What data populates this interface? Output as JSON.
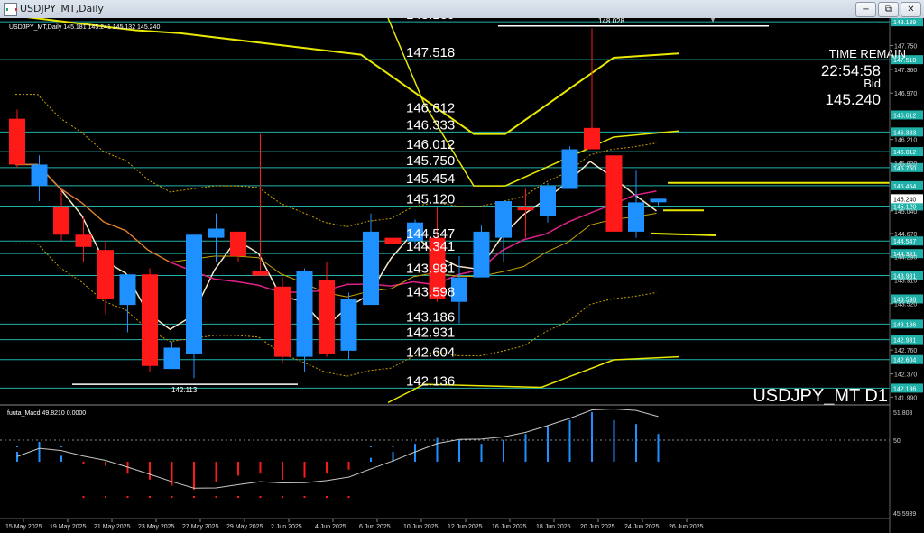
{
  "window": {
    "title": "USDJPY_MT,Daily",
    "minimize_glyph": "−",
    "restore_glyph": "⧉",
    "close_glyph": "✕"
  },
  "chart_header": "USDJPY_MT,Daily  145.181 145.241 145.132 145.240",
  "watermark": "USDJPY_MT D1",
  "time_remain": {
    "label": "TIME REMAIN",
    "value": "22:54:58",
    "bid_label": "Bid",
    "bid_value": "145.240"
  },
  "level_labels": [
    {
      "text": "148.139",
      "y": 148.139
    },
    {
      "text": "147.518",
      "y": 147.518
    },
    {
      "text": "146.612",
      "y": 146.612
    },
    {
      "text": "146.333",
      "y": 146.333
    },
    {
      "text": "146.012",
      "y": 146.012
    },
    {
      "text": "145.750",
      "y": 145.75
    },
    {
      "text": "145.454",
      "y": 145.454
    },
    {
      "text": "145.120",
      "y": 145.12
    },
    {
      "text": "144.547",
      "y": 144.547
    },
    {
      "text": "144.341",
      "y": 144.341
    },
    {
      "text": "143.981",
      "y": 143.981
    },
    {
      "text": "143.598",
      "y": 143.598
    },
    {
      "text": "143.186",
      "y": 143.186
    },
    {
      "text": "142.931",
      "y": 142.931
    },
    {
      "text": "142.604",
      "y": 142.604
    },
    {
      "text": "142.136",
      "y": 142.136
    }
  ],
  "high_marker": "148.028",
  "low_marker": "142.113",
  "price_scale_ticks": [
    "147.750",
    "147.360",
    "146.970",
    "146.210",
    "145.820",
    "145.040",
    "144.670",
    "144.290",
    "143.910",
    "143.520",
    "142.760",
    "142.370",
    "141.990"
  ],
  "current_price_tag": "145.240",
  "macd": {
    "label": "fuuta_Macd 49.8210  0.0000",
    "scale": [
      "51.808",
      "50",
      "45.5939"
    ],
    "value": 49.821,
    "signal": 0.0
  },
  "date_labels": [
    "15 May 2025",
    "19 May 2025",
    "21 May 2025",
    "23 May 2025",
    "27 May 2025",
    "29 May 2025",
    "2 Jun 2025",
    "4 Jun 2025",
    "6 Jun 2025",
    "10 Jun 2025",
    "12 Jun 2025",
    "16 Jun 2025",
    "18 Jun 2025",
    "20 Jun 2025",
    "24 Jun 2025",
    "26 Jun 2025"
  ],
  "colors": {
    "bull": "#1e90ff",
    "bear": "#ff1a1a",
    "level": "#20b2aa",
    "yellow": "#e8e800",
    "ma_fast": "#f5e6c8",
    "ma_pink": "#e0218a",
    "label_bg": "#20b2aa"
  },
  "chart_data": {
    "type": "candlestick",
    "y_range": [
      141.95,
      148.2
    ],
    "candles": [
      {
        "o": 146.55,
        "h": 146.7,
        "l": 145.75,
        "c": 145.8
      },
      {
        "o": 145.45,
        "h": 145.95,
        "l": 145.2,
        "c": 145.8
      },
      {
        "o": 145.1,
        "h": 145.4,
        "l": 144.55,
        "c": 144.65
      },
      {
        "o": 144.65,
        "h": 144.95,
        "l": 144.2,
        "c": 144.45
      },
      {
        "o": 144.4,
        "h": 144.55,
        "l": 143.35,
        "c": 143.6
      },
      {
        "o": 143.5,
        "h": 144.0,
        "l": 143.05,
        "c": 144.0
      },
      {
        "o": 144.0,
        "h": 144.1,
        "l": 142.4,
        "c": 142.5
      },
      {
        "o": 142.45,
        "h": 142.9,
        "l": 142.45,
        "c": 142.8
      },
      {
        "o": 142.7,
        "h": 144.5,
        "l": 142.3,
        "c": 144.65
      },
      {
        "o": 144.6,
        "h": 145.0,
        "l": 144.2,
        "c": 144.75
      },
      {
        "o": 144.7,
        "h": 144.7,
        "l": 144.2,
        "c": 144.3
      },
      {
        "o": 144.05,
        "h": 146.3,
        "l": 144.05,
        "c": 143.98
      },
      {
        "o": 143.8,
        "h": 143.95,
        "l": 142.55,
        "c": 142.65
      },
      {
        "o": 142.65,
        "h": 144.1,
        "l": 142.4,
        "c": 144.05
      },
      {
        "o": 143.9,
        "h": 144.2,
        "l": 142.65,
        "c": 142.7
      },
      {
        "o": 142.75,
        "h": 143.7,
        "l": 142.6,
        "c": 143.6
      },
      {
        "o": 143.5,
        "h": 145.0,
        "l": 143.5,
        "c": 144.7
      },
      {
        "o": 144.6,
        "h": 144.85,
        "l": 144.45,
        "c": 144.5
      },
      {
        "o": 144.55,
        "h": 144.9,
        "l": 144.5,
        "c": 144.85
      },
      {
        "o": 144.6,
        "h": 145.1,
        "l": 143.55,
        "c": 143.6
      },
      {
        "o": 143.55,
        "h": 144.3,
        "l": 143.2,
        "c": 143.95
      },
      {
        "o": 143.95,
        "h": 144.8,
        "l": 143.95,
        "c": 144.7
      },
      {
        "o": 144.6,
        "h": 145.2,
        "l": 144.2,
        "c": 145.2
      },
      {
        "o": 145.1,
        "h": 145.4,
        "l": 144.6,
        "c": 145.05
      },
      {
        "o": 144.95,
        "h": 145.5,
        "l": 144.85,
        "c": 145.45
      },
      {
        "o": 145.4,
        "h": 146.1,
        "l": 145.4,
        "c": 146.05
      },
      {
        "o": 146.4,
        "h": 148.028,
        "l": 146.05,
        "c": 146.05
      },
      {
        "o": 145.95,
        "h": 146.2,
        "l": 144.55,
        "c": 144.7
      },
      {
        "o": 144.7,
        "h": 145.7,
        "l": 144.6,
        "c": 145.18
      },
      {
        "o": 145.181,
        "h": 145.241,
        "l": 145.132,
        "c": 145.24
      }
    ],
    "macd_histogram": [
      0.5,
      1.0,
      0.3,
      -0.1,
      -0.2,
      -0.6,
      -0.9,
      -1.2,
      -1.4,
      -1.0,
      -0.7,
      -0.6,
      -0.9,
      -0.8,
      -0.6,
      -0.4,
      0.2,
      0.5,
      0.9,
      1.2,
      1.1,
      0.9,
      1.1,
      1.4,
      1.8,
      2.1,
      2.5,
      2.1,
      1.9,
      1.4
    ]
  }
}
